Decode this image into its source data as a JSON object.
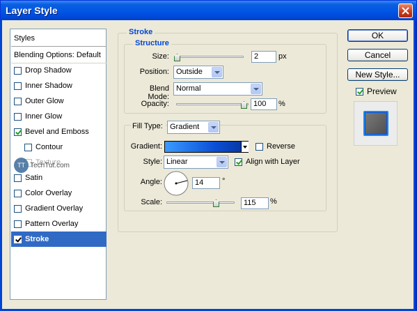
{
  "window": {
    "title": "Layer Style"
  },
  "styles_panel": {
    "header": "Styles",
    "blending": "Blending Options: Default",
    "items": [
      {
        "label": "Drop Shadow",
        "checked": false
      },
      {
        "label": "Inner Shadow",
        "checked": false
      },
      {
        "label": "Outer Glow",
        "checked": false
      },
      {
        "label": "Inner Glow",
        "checked": false
      },
      {
        "label": "Bevel and Emboss",
        "checked": true
      },
      {
        "label": "Contour",
        "checked": false
      },
      {
        "label": "Texture",
        "checked": false
      },
      {
        "label": "Satin",
        "checked": false
      },
      {
        "label": "Color Overlay",
        "checked": false
      },
      {
        "label": "Gradient Overlay",
        "checked": false
      },
      {
        "label": "Pattern Overlay",
        "checked": false
      },
      {
        "label": "Stroke",
        "checked": true,
        "selected": true
      }
    ],
    "watermark": "TechTut.com"
  },
  "stroke": {
    "title": "Stroke",
    "structure_title": "Structure",
    "size_label": "Size:",
    "size_value": "2",
    "size_unit": "px",
    "position_label": "Position:",
    "position_value": "Outside",
    "blend_label": "Blend Mode:",
    "blend_value": "Normal",
    "opacity_label": "Opacity:",
    "opacity_value": "100",
    "opacity_unit": "%",
    "filltype_label": "Fill Type:",
    "filltype_value": "Gradient",
    "gradient_label": "Gradient:",
    "reverse_label": "Reverse",
    "reverse_checked": false,
    "style_label": "Style:",
    "style_value": "Linear",
    "align_label": "Align with Layer",
    "align_checked": true,
    "angle_label": "Angle:",
    "angle_value": "14",
    "angle_unit": "°",
    "scale_label": "Scale:",
    "scale_value": "115",
    "scale_unit": "%"
  },
  "buttons": {
    "ok": "OK",
    "cancel": "Cancel",
    "new_style": "New Style...",
    "preview_label": "Preview",
    "preview_checked": true
  },
  "colors": {
    "titlebar": "#0055e5",
    "selection": "#316ac5",
    "accent": "#0046d5"
  }
}
